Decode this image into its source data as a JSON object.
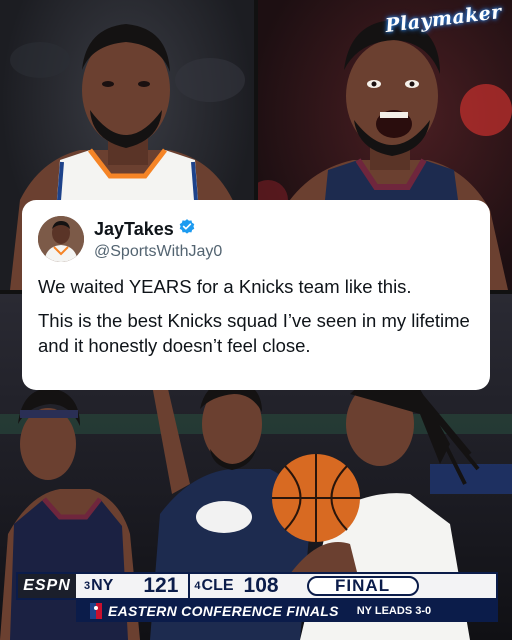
{
  "brand": {
    "logo_text": "Playmaker"
  },
  "tweet": {
    "display_name": "JayTakes",
    "handle": "@SportsWithJay0",
    "verified": true,
    "paragraphs": [
      "We waited YEARS for a Knicks team like this.",
      "This is the best Knicks squad I’ve seen in my lifetime and it honestly doesn’t feel close."
    ]
  },
  "scoreboard": {
    "network": "ESPN",
    "home": {
      "seed": "3",
      "team": "NY",
      "score": "121"
    },
    "away": {
      "seed": "4",
      "team": "CLE",
      "score": "108"
    },
    "status": "FINAL",
    "round": "EASTERN CONFERENCE FINALS",
    "series_status": "NY LEADS 3-0"
  },
  "colors": {
    "tweet_bg": "#ffffff",
    "verified_blue": "#1d9bf0",
    "bug_navy": "#0b1c4a",
    "knicks_orange": "#f58426",
    "cavs_wine": "#6f263d"
  }
}
